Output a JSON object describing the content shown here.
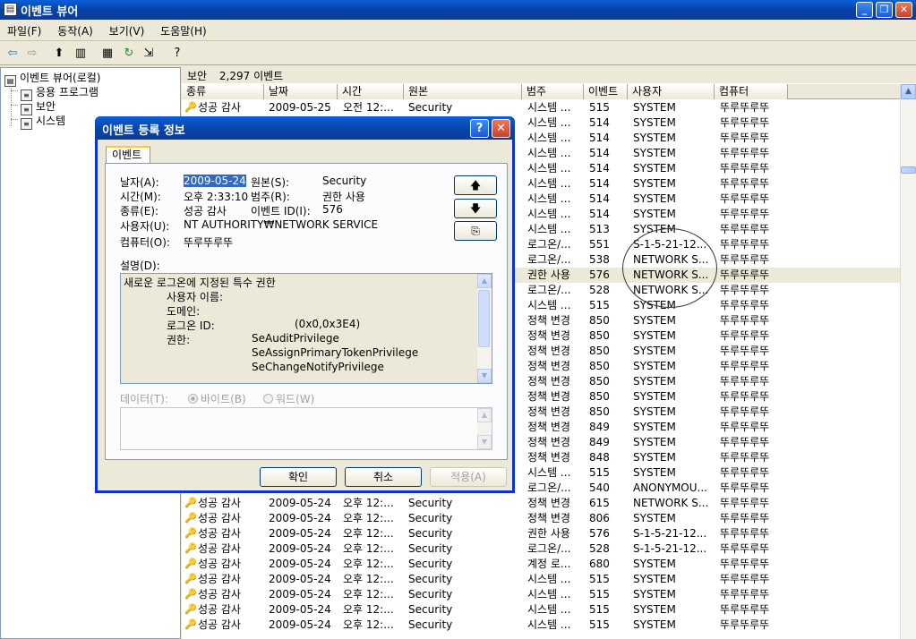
{
  "window": {
    "title": "이벤트 뷰어",
    "app_icon": "event-viewer-icon"
  },
  "menu": [
    "파일(F)",
    "동작(A)",
    "보기(V)",
    "도움말(H)"
  ],
  "tree": {
    "root": "이벤트 뷰어(로컬)",
    "children": [
      "응용 프로그램",
      "보안",
      "시스템"
    ]
  },
  "panel": {
    "name": "보안",
    "count": "2,297 이벤트"
  },
  "columns": [
    "종류",
    "날짜",
    "시간",
    "원본",
    "범주",
    "이벤트",
    "사용자",
    "컴퓨터"
  ],
  "rows_top": [
    {
      "type": "성공 감사",
      "date": "2009-05-25",
      "time": "오전 12:...",
      "source": "Security",
      "cat": "시스템 ...",
      "id": "515",
      "user": "SYSTEM",
      "comp": "뚜루뚜루뚜"
    },
    {
      "cat": "시스템 ...",
      "id": "514",
      "user": "SYSTEM",
      "comp": "뚜루뚜루뚜"
    },
    {
      "cat": "시스템 ...",
      "id": "514",
      "user": "SYSTEM",
      "comp": "뚜루뚜루뚜"
    },
    {
      "cat": "시스템 ...",
      "id": "514",
      "user": "SYSTEM",
      "comp": "뚜루뚜루뚜"
    },
    {
      "cat": "시스템 ...",
      "id": "514",
      "user": "SYSTEM",
      "comp": "뚜루뚜루뚜"
    },
    {
      "cat": "시스템 ...",
      "id": "514",
      "user": "SYSTEM",
      "comp": "뚜루뚜루뚜"
    },
    {
      "cat": "시스템 ...",
      "id": "514",
      "user": "SYSTEM",
      "comp": "뚜루뚜루뚜"
    },
    {
      "cat": "시스템 ...",
      "id": "514",
      "user": "SYSTEM",
      "comp": "뚜루뚜루뚜"
    },
    {
      "cat": "시스템 ...",
      "id": "513",
      "user": "SYSTEM",
      "comp": "뚜루뚜루뚜"
    },
    {
      "cat": "로그온/...",
      "id": "551",
      "user": "S-1-5-21-12...",
      "comp": "뚜루뚜루뚜"
    },
    {
      "cat": "로그온/...",
      "id": "538",
      "user": "NETWORK S...",
      "comp": "뚜루뚜루뚜"
    },
    {
      "cat": "권한 사용",
      "id": "576",
      "user": "NETWORK S...",
      "comp": "뚜루뚜루뚜",
      "sel": true
    },
    {
      "cat": "로그온/...",
      "id": "528",
      "user": "NETWORK S...",
      "comp": "뚜루뚜루뚜"
    },
    {
      "cat": "시스템 ...",
      "id": "515",
      "user": "SYSTEM",
      "comp": "뚜루뚜루뚜"
    },
    {
      "cat": "정책 변경",
      "id": "850",
      "user": "SYSTEM",
      "comp": "뚜루뚜루뚜"
    },
    {
      "cat": "정책 변경",
      "id": "850",
      "user": "SYSTEM",
      "comp": "뚜루뚜루뚜"
    },
    {
      "cat": "정책 변경",
      "id": "850",
      "user": "SYSTEM",
      "comp": "뚜루뚜루뚜"
    },
    {
      "cat": "정책 변경",
      "id": "850",
      "user": "SYSTEM",
      "comp": "뚜루뚜루뚜"
    },
    {
      "cat": "정책 변경",
      "id": "850",
      "user": "SYSTEM",
      "comp": "뚜루뚜루뚜"
    },
    {
      "cat": "정책 변경",
      "id": "850",
      "user": "SYSTEM",
      "comp": "뚜루뚜루뚜"
    },
    {
      "cat": "정책 변경",
      "id": "850",
      "user": "SYSTEM",
      "comp": "뚜루뚜루뚜"
    },
    {
      "cat": "정책 변경",
      "id": "849",
      "user": "SYSTEM",
      "comp": "뚜루뚜루뚜"
    },
    {
      "cat": "정책 변경",
      "id": "849",
      "user": "SYSTEM",
      "comp": "뚜루뚜루뚜"
    },
    {
      "cat": "정책 변경",
      "id": "848",
      "user": "SYSTEM",
      "comp": "뚜루뚜루뚜"
    },
    {
      "cat": "시스템 ...",
      "id": "515",
      "user": "SYSTEM",
      "comp": "뚜루뚜루뚜"
    },
    {
      "cat": "로그온/...",
      "id": "540",
      "user": "ANONYMOU...",
      "comp": "뚜루뚜루뚜"
    }
  ],
  "rows_full": [
    {
      "type": "성공 감사",
      "date": "2009-05-24",
      "time": "오후 12:...",
      "source": "Security",
      "cat": "정책 변경",
      "id": "615",
      "user": "NETWORK S...",
      "comp": "뚜루뚜루뚜"
    },
    {
      "type": "성공 감사",
      "date": "2009-05-24",
      "time": "오후 12:...",
      "source": "Security",
      "cat": "정책 변경",
      "id": "806",
      "user": "SYSTEM",
      "comp": "뚜루뚜루뚜"
    },
    {
      "type": "성공 감사",
      "date": "2009-05-24",
      "time": "오후 12:...",
      "source": "Security",
      "cat": "권한 사용",
      "id": "576",
      "user": "S-1-5-21-12...",
      "comp": "뚜루뚜루뚜"
    },
    {
      "type": "성공 감사",
      "date": "2009-05-24",
      "time": "오후 12:...",
      "source": "Security",
      "cat": "로그온/...",
      "id": "528",
      "user": "S-1-5-21-12...",
      "comp": "뚜루뚜루뚜"
    },
    {
      "type": "성공 감사",
      "date": "2009-05-24",
      "time": "오후 12:...",
      "source": "Security",
      "cat": "계정 로...",
      "id": "680",
      "user": "SYSTEM",
      "comp": "뚜루뚜루뚜"
    },
    {
      "type": "성공 감사",
      "date": "2009-05-24",
      "time": "오후 12:...",
      "source": "Security",
      "cat": "시스템 ...",
      "id": "515",
      "user": "SYSTEM",
      "comp": "뚜루뚜루뚜"
    },
    {
      "type": "성공 감사",
      "date": "2009-05-24",
      "time": "오후 12:...",
      "source": "Security",
      "cat": "시스템 ...",
      "id": "515",
      "user": "SYSTEM",
      "comp": "뚜루뚜루뚜"
    },
    {
      "type": "성공 감사",
      "date": "2009-05-24",
      "time": "오후 12:...",
      "source": "Security",
      "cat": "시스템 ...",
      "id": "515",
      "user": "SYSTEM",
      "comp": "뚜루뚜루뚜"
    },
    {
      "type": "성공 감사",
      "date": "2009-05-24",
      "time": "오후 12:...",
      "source": "Security",
      "cat": "시스템 ...",
      "id": "515",
      "user": "SYSTEM",
      "comp": "뚜루뚜루뚜"
    }
  ],
  "dialog": {
    "title": "이벤트 등록 정보",
    "tab": "이벤트",
    "labels": {
      "date": "날자(A):",
      "time": "시간(M):",
      "type": "종류(E):",
      "user": "사용자(U):",
      "computer": "컴퓨터(O):",
      "source": "원본(S):",
      "category": "범주(R):",
      "event_id": "이벤트 ID(I):",
      "description": "설명(D):",
      "data": "데이터(T):"
    },
    "values": {
      "date": "2009-05-24",
      "time": "오후 2:33:10",
      "type": "성공 감사",
      "user": "NT AUTHORITY₩NETWORK SERVICE",
      "computer": "뚜루뚜루뚜",
      "source": "Security",
      "category": "권한 사용",
      "event_id": "576"
    },
    "description": {
      "line1": "새로운 로그온에 지정된 특수 권한",
      "user_label": "사용자 이름:",
      "domain_label": "도메인:",
      "logon_label": "로그온 ID:",
      "logon_value": "(0x0,0x3E4)",
      "priv_label": "권한:",
      "privs": [
        "SeAuditPrivilege",
        "SeAssignPrimaryTokenPrivilege",
        "SeChangeNotifyPrivilege"
      ]
    },
    "radio_bytes": "바이트(B)",
    "radio_words": "워드(W)",
    "buttons": {
      "ok": "확인",
      "cancel": "취소",
      "apply": "적용(A)"
    }
  }
}
